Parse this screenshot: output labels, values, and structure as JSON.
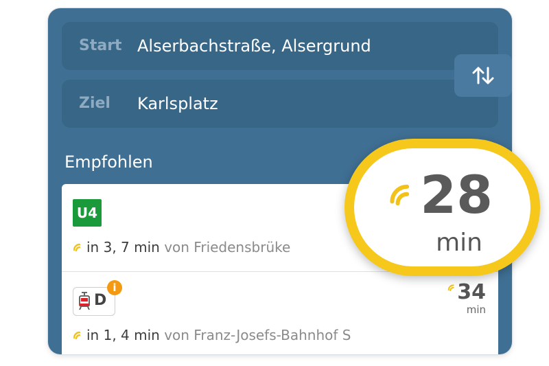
{
  "route": {
    "start_label": "Start",
    "start_value": "Alserbachstraße, Alsergrund",
    "ziel_label": "Ziel",
    "ziel_value": "Karlsplatz",
    "swap_icon": "swap-vertical-arrows-icon"
  },
  "section": {
    "title": "Empfohlen"
  },
  "connections": [
    {
      "line": "U4",
      "line_color": "#1b9a3b",
      "departure": "in 3, 7 min",
      "from": "von Friedensbrüke",
      "duration": "28",
      "duration_unit": "min"
    },
    {
      "line": "D",
      "line_type": "tram",
      "has_alert": true,
      "alert_symbol": "i",
      "departure": "in 1, 4 min",
      "from": "von Franz-Josefs-Bahnhof S",
      "duration": "34",
      "duration_unit": "min"
    }
  ],
  "colors": {
    "panel": "#3f6f93",
    "highlight": "#f6c81c",
    "realtime": "#f2c21b"
  }
}
